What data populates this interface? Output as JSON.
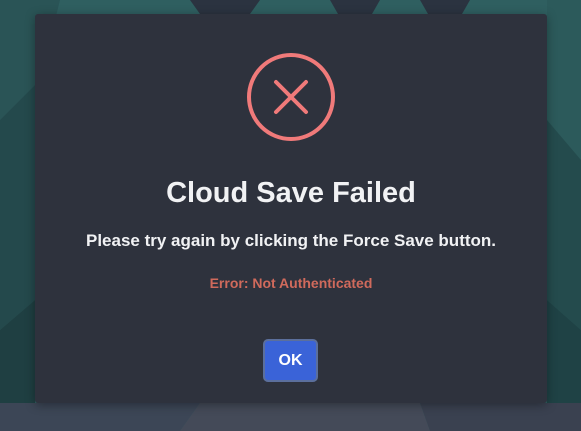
{
  "dialog": {
    "icon": "x-circle-icon",
    "title": "Cloud Save Failed",
    "message": "Please try again by clicking the Force Save button.",
    "error": "Error: Not Authenticated",
    "ok_label": "OK"
  },
  "colors": {
    "dialog_bg": "#2e323d",
    "icon_accent": "#f07a7a",
    "error_text": "#d06a5c",
    "button_bg": "#3a63d8",
    "backdrop": "#2f5e5f"
  }
}
